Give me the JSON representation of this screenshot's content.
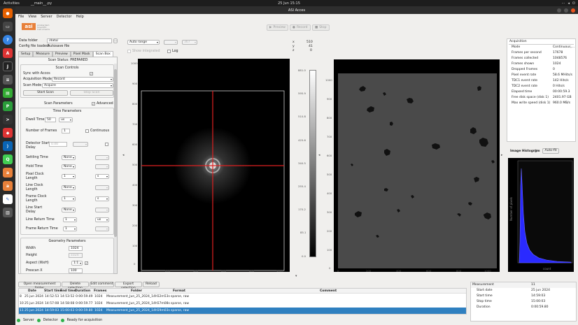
{
  "topbar": {
    "activities": "Activities",
    "app": "__main__.py",
    "clock": "25 Jun  15:15"
  },
  "window": {
    "title": "ASI Acces"
  },
  "menu": [
    "File",
    "View",
    "Server",
    "Detector",
    "Help"
  ],
  "logo": {
    "text": "asi",
    "sub1": "Amsterdam",
    "sub2": "Scientific Instruments"
  },
  "toolbar": {
    "preview": "Preview",
    "record": "Record",
    "stop": "Stop"
  },
  "left": {
    "data_folder_label": "Data folder",
    "data_folder_value": "/data/",
    "config_label": "Config file loaded:",
    "config_value": "Autosave file",
    "tabs": [
      "Setup",
      "Measure",
      "Preview",
      "Pixel Mask",
      "Scan Box"
    ],
    "scan_status": "Scan Status: PREPARED",
    "scan_controls_title": "Scan Controls",
    "sync_label": "Sync with Accos",
    "acq_mode_label": "Acquisition Mode",
    "acq_mode_value": "Record",
    "scan_mode_label": "Scan Mode",
    "scan_mode_value": "Acquire",
    "start_scan": "Start Scan",
    "stop_scan": "Stop Scan",
    "scan_params_title": "Scan Parameters",
    "advanced": "Advanced",
    "time_params_title": "Time Parameters",
    "dwell_label": "Dwell Time",
    "dwell_value": "50",
    "dwell_unit": "us",
    "frames_label": "Number of Frames",
    "frames_value": "1",
    "continuous": "Continuous",
    "det_delay_label": "Detector Start Delay",
    "det_delay_value": "0.00",
    "settling_label": "Settling Time",
    "settling_value": "None",
    "hold_label": "Hold Time",
    "hold_value": "None",
    "pixclk_label": "Pixel Clock Length",
    "pixclk_value": "1",
    "pixclk_unit": "s",
    "lineclk_label": "Line Clock Length",
    "lineclk_value": "None",
    "frameclk_label": "Frame Clock Length",
    "frameclk_value": "1",
    "frameclk_unit": "s",
    "linestart_label": "Line Start Delay",
    "linestart_value": "None",
    "linereturn_label": "Line Return Time",
    "linereturn_value": "1",
    "linereturn_unit": "us",
    "framereturn_label": "Frame Return Time",
    "framereturn_value": "1",
    "geom_title": "Geometry Parameters",
    "width_label": "Width",
    "width_value": "1024",
    "height_label": "Height",
    "height_value": "1024",
    "aspect_label": "Aspect (WxH)",
    "aspect_value": "1:1",
    "prescan_label": "Prescan X",
    "prescan_value": "100"
  },
  "view": {
    "range": "Auto range",
    "show_integrated": "Show integrated",
    "log": "Log",
    "range_val": "367"
  },
  "xyz": {
    "x_label": "x",
    "x": "510",
    "y_label": "y",
    "y": "41",
    "z_label": "z",
    "z": "0"
  },
  "colorbar": [
    "881.0",
    "595.9",
    "510.8",
    "425.6",
    "340.5",
    "255.4",
    "170.2",
    "85.1",
    "0.0"
  ],
  "img1_yticks": [
    "0",
    "100",
    "200",
    "300",
    "400",
    "500",
    "600",
    "700",
    "800",
    "900",
    "1000"
  ],
  "img1_xticks": [
    "0",
    "200",
    "400",
    "600",
    "800",
    "1000"
  ],
  "img2_yticks": [
    "0",
    "100",
    "200",
    "300",
    "400",
    "500",
    "600",
    "700",
    "800",
    "900",
    "1000"
  ],
  "img2_xticks": [
    "0",
    "200",
    "400",
    "600",
    "800",
    "1000"
  ],
  "acquisition": {
    "title": "Acquisition",
    "rows": [
      {
        "k": "Mode",
        "v": "Continuous,..."
      },
      {
        "k": "Frames per second",
        "v": "17678"
      },
      {
        "k": "Frames collected",
        "v": "1048576"
      },
      {
        "k": "Frames shown",
        "v": "1024"
      },
      {
        "k": "Dropped Frames",
        "v": "0"
      },
      {
        "k": "Pixel event rate",
        "v": "58.6 MHits/s"
      },
      {
        "k": "TDC1 event rate",
        "v": "142 Hits/s"
      },
      {
        "k": "TDC2 event rate",
        "v": "0 Hits/s"
      },
      {
        "k": "Elapsed time",
        "v": "00:00:59.3"
      },
      {
        "k": "Free disk space (disk 1)",
        "v": "2401.97 GB"
      },
      {
        "k": "Max write speed (disk 1)",
        "v": "960.0 MB/s"
      }
    ]
  },
  "histogram": {
    "title": "Image Histogram",
    "autofit": "Auto-fit",
    "ylabel": "Number of pixels",
    "xlabel": "count"
  },
  "table_buttons": [
    "Open measurement folder",
    "Delete selection",
    "Edit comment",
    "Export selection",
    "Reload"
  ],
  "table": {
    "headers": [
      "",
      "Date",
      "Start time",
      "End time",
      "Duration",
      "Frames",
      "Folder",
      "Format",
      "Comment"
    ],
    "rows": [
      [
        "8",
        "25 jun 2024",
        "14:52:53",
        "14:53:52",
        "0:00:59.49",
        "1024",
        "Measurement_Jun_25_2024_14h52m53s",
        "sparse, raw",
        ""
      ],
      [
        "10",
        "25 jun 2024",
        "14:57:08",
        "14:58:08",
        "0:00:59.77",
        "1024",
        "Measurement_Jun_25_2024_14h57m08s",
        "sparse, raw",
        ""
      ],
      [
        "11",
        "25 jun 2024",
        "14:59:03",
        "15:00:03",
        "0:00:59.80",
        "1024",
        "Measurement_Jun_25_2024_14h59m03s",
        "sparse, raw",
        ""
      ]
    ]
  },
  "measurement": {
    "header_k": "Measurement",
    "header_v": "11",
    "rows": [
      {
        "k": "Start date",
        "v": "25 jun 2024"
      },
      {
        "k": "Start time",
        "v": "14:59:03"
      },
      {
        "k": "Stop time",
        "v": "15:00:03"
      },
      {
        "k": "Duration",
        "v": "0:00:59.80"
      }
    ]
  },
  "status": {
    "server": "Server",
    "detector": "Detector",
    "ready": "Ready for acquisition"
  }
}
